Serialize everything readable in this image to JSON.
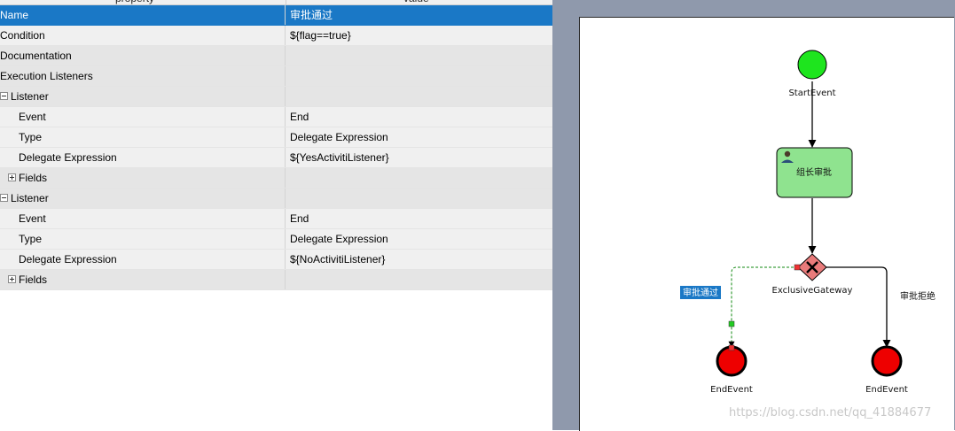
{
  "properties_panel": {
    "columns": {
      "property": "property",
      "value": "value"
    },
    "rows": [
      {
        "key": "Name",
        "value": "审批通过",
        "level": 0,
        "style": "selected"
      },
      {
        "key": "Condition",
        "value": "${flag==true}",
        "level": 0,
        "style": "normal"
      },
      {
        "key": "Documentation",
        "value": "",
        "level": 0,
        "style": "category"
      },
      {
        "key": "Execution Listeners",
        "value": "",
        "level": 0,
        "style": "category"
      },
      {
        "key": "Listener",
        "value": "",
        "level": 0,
        "style": "category",
        "toggle": "minus"
      },
      {
        "key": "Event",
        "value": "End",
        "level": 2,
        "style": "normal"
      },
      {
        "key": "Type",
        "value": "Delegate Expression",
        "level": 2,
        "style": "normal"
      },
      {
        "key": "Delegate Expression",
        "value": "${YesActivitiListener}",
        "level": 2,
        "style": "normal"
      },
      {
        "key": "Fields",
        "value": "",
        "level": 1,
        "style": "category",
        "toggle": "plus"
      },
      {
        "key": "Listener",
        "value": "",
        "level": 0,
        "style": "category",
        "toggle": "minus"
      },
      {
        "key": "Event",
        "value": "End",
        "level": 2,
        "style": "normal"
      },
      {
        "key": "Type",
        "value": "Delegate Expression",
        "level": 2,
        "style": "normal"
      },
      {
        "key": "Delegate Expression",
        "value": "${NoActivitiListener}",
        "level": 2,
        "style": "normal"
      },
      {
        "key": "Fields",
        "value": "",
        "level": 1,
        "style": "category",
        "toggle": "plus"
      }
    ]
  },
  "diagram": {
    "start_event": "StartEvent",
    "user_task": "组长审批",
    "gateway": "ExclusiveGateway",
    "end_event_left": "EndEvent",
    "end_event_right": "EndEvent",
    "flow_approve_label": "审批通过",
    "flow_reject_label": "审批拒绝",
    "colors": {
      "start_fill": "#1ee51e",
      "task_fill": "#8fe38f",
      "gateway_fill": "#e97b7b",
      "end_fill": "#ee0000",
      "selected_label_bg": "#1a78c6"
    }
  },
  "watermark": "https://blog.csdn.net/qq_41884677"
}
